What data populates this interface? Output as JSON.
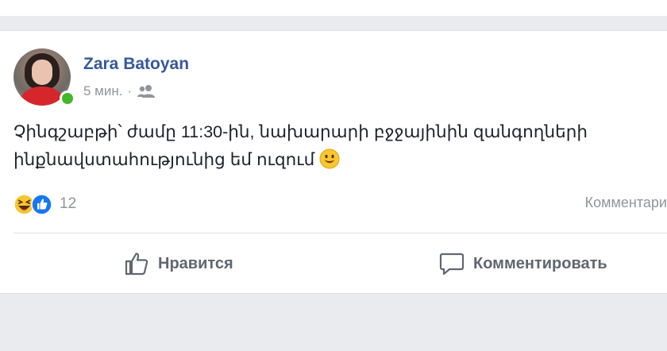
{
  "post": {
    "author": "Zara Batoyan",
    "time": "5 мин.",
    "separator": "·",
    "privacy_icon": "friends-icon",
    "text_line1": "Չինգշաբթի՝ ժամը 11:30-ին, նախարարի բջջայինին զանգողների",
    "text_line2": "ինքնավստահությունից եմ ուզում",
    "emoji": "smiley-emoji"
  },
  "reactions": {
    "types": [
      "haha",
      "like"
    ],
    "count": "12",
    "comments_label": "Комментари"
  },
  "actions": {
    "like_label": "Нравится",
    "comment_label": "Комментировать"
  },
  "colors": {
    "author_link": "#365899",
    "meta_gray": "#90949c",
    "action_gray": "#606770",
    "online_green": "#42b72a",
    "like_blue": "#1877f2"
  }
}
